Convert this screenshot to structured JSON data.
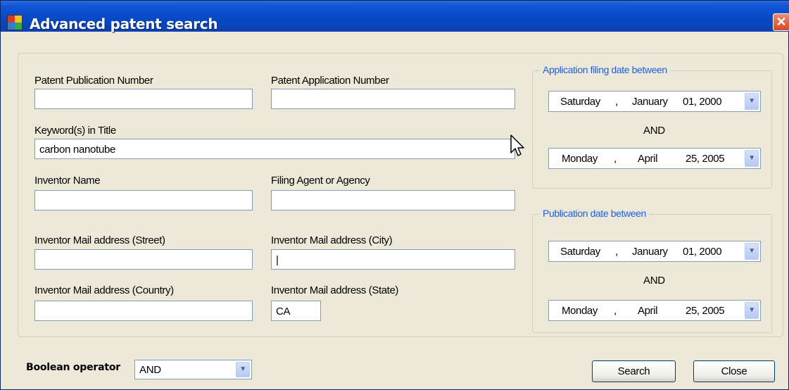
{
  "window": {
    "title": "Advanced patent search",
    "close_glyph": "✕",
    "app_icon": "app-grid-icon"
  },
  "form": {
    "patent_publication_number": {
      "label": "Patent Publication Number",
      "value": ""
    },
    "patent_application_number": {
      "label": "Patent Application Number",
      "value": ""
    },
    "keywords_in_title": {
      "label": "Keyword(s) in Title",
      "value": "carbon nanotube"
    },
    "inventor_name": {
      "label": "Inventor Name",
      "value": ""
    },
    "filing_agent": {
      "label": "Filing Agent or Agency",
      "value": ""
    },
    "inventor_street": {
      "label": "Inventor Mail address (Street)",
      "value": ""
    },
    "inventor_city": {
      "label": "Inventor Mail address (City)",
      "value": "|"
    },
    "inventor_country": {
      "label": "Inventor Mail address (Country)",
      "value": ""
    },
    "inventor_state": {
      "label": "Inventor Mail address (State)",
      "value": "CA"
    }
  },
  "application_filing_date": {
    "title": "Application filing date between",
    "from": {
      "weekday": "Saturday",
      "sep": ",",
      "month": "January",
      "date": "01, 2000"
    },
    "and_label": "AND",
    "to": {
      "weekday": "Monday",
      "sep": ",",
      "month": "April",
      "date": "25, 2005"
    }
  },
  "publication_date": {
    "title": "Publication date between",
    "from": {
      "weekday": "Saturday",
      "sep": ",",
      "month": "January",
      "date": "01, 2000"
    },
    "and_label": "AND",
    "to": {
      "weekday": "Monday",
      "sep": ",",
      "month": "April",
      "date": "25, 2005"
    }
  },
  "boolean_operator": {
    "label": "Boolean operator",
    "selected": "AND"
  },
  "buttons": {
    "search": "Search",
    "close": "Close"
  },
  "colors": {
    "titlebar": "#0a4ec8",
    "window_bg": "#ece9d8",
    "group_title": "#1e5ee6",
    "input_border": "#7f9db9"
  }
}
